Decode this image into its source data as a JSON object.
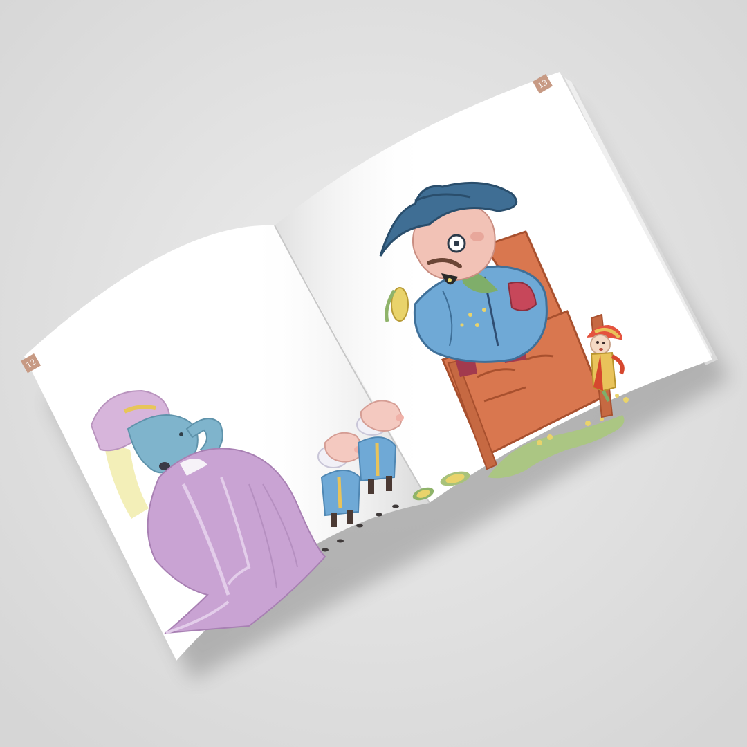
{
  "scene": {
    "background_color": "#e4e4e4",
    "page_color": "#ffffff",
    "page_number_badge_color": "#c79a84"
  },
  "book": {
    "left_page": {
      "page_number": "12"
    },
    "right_page": {
      "page_number": "13"
    }
  },
  "illustration": {
    "characters": [
      "hippo-lady-in-purple-gown",
      "small-pig-servant",
      "small-pig-servant",
      "mayor-pig-in-blue-hat",
      "jester-doll"
    ],
    "props": [
      "carved-wooden-throne",
      "corn-cob",
      "green-spill"
    ]
  }
}
